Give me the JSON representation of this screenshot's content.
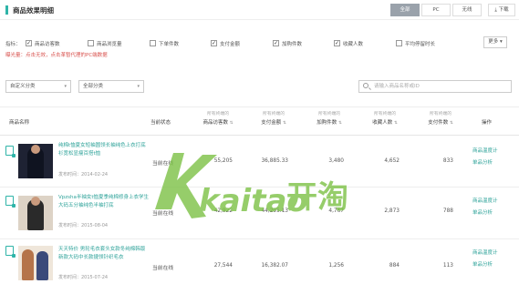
{
  "header": {
    "title": "商品效果明细",
    "segments": [
      "全部",
      "PC",
      "无线"
    ],
    "download_label": "下载",
    "download_icon": "download-icon"
  },
  "indicators": {
    "label": "指标：",
    "items": [
      {
        "label": "商品访客数",
        "checked": true
      },
      {
        "label": "商品浏览量",
        "checked": false
      },
      {
        "label": "下单件数",
        "checked": false
      },
      {
        "label": "支付金额",
        "checked": true
      },
      {
        "label": "加购件数",
        "checked": true
      },
      {
        "label": "收藏人数",
        "checked": true
      },
      {
        "label": "平均停留时长",
        "checked": false
      }
    ],
    "more_label": "更多",
    "hint": "曝光量：点击无效，点击革暂代理的PC端数据"
  },
  "filters": {
    "category": "自定义分类",
    "all_category": "全部分类",
    "search_placeholder": "请输入商品名称或ID"
  },
  "table": {
    "headers": {
      "name": "商品名称",
      "status": "当前状态",
      "visitors": "商品访客数",
      "pay": "支付金额",
      "cart": "加购件数",
      "fav": "收藏人数",
      "paycount": "支付件数",
      "op": "操作"
    },
    "sub_header": "所有终端的",
    "rows": [
      {
        "name": "纯棉t恤夏女短袖圆领长袖纯色上衣打底衫宽松显瘦百搭t恤",
        "time": "发布时间：2014-02-24",
        "status": "当前在线",
        "visitors": "55,205",
        "pay": "36,885.33",
        "cart": "3,480",
        "fav": "4,652",
        "paycount": "833",
        "op1": "商品温度计",
        "op2": "单品分析"
      },
      {
        "name": "Vpzsha半袖女t恤夏季纯棉修身上衣学生大码五分袖纯色半袖打底",
        "time": "发布时间：2015-08-04",
        "status": "当前在线",
        "visitors": "42,922",
        "pay": "44,295.13",
        "cart": "4,767",
        "fav": "2,873",
        "paycount": "788",
        "op1": "商品温度计",
        "op2": "单品分析"
      },
      {
        "name": "天天特价 男轮毛衣套头女款冬纯棉韩版新款大码中长款捷领针织毛衣",
        "time": "发布时间：2015-07-24",
        "status": "当前在线",
        "visitors": "27,544",
        "pay": "16,382.07",
        "cart": "1,256",
        "fav": "884",
        "paycount": "113",
        "op1": "商品温度计",
        "op2": "单品分析"
      }
    ]
  },
  "watermark": {
    "latin": "kaitao",
    "cjk": "开淘"
  },
  "colors": {
    "accent": "#2fb4a8",
    "hint": "#d9534f",
    "watermark": "#7fc34a"
  }
}
